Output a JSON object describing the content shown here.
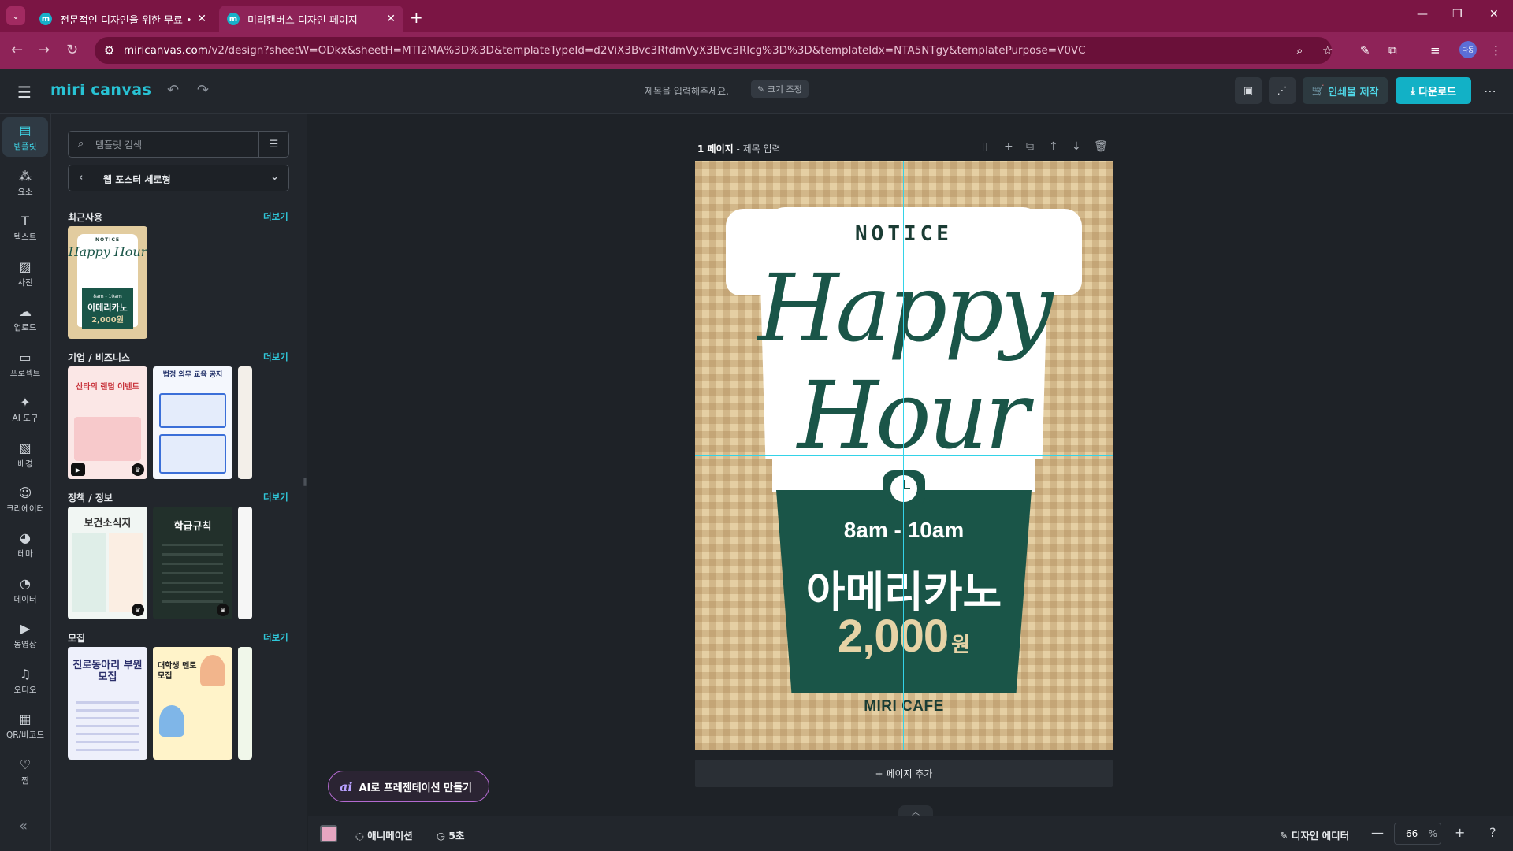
{
  "browser": {
    "tabs": [
      {
        "title": "전문적인 디자인을 위한 무료 •",
        "active": false
      },
      {
        "title": "미리캔버스 디자인 페이지",
        "active": true
      }
    ],
    "url_host": "miricanvas.com",
    "url_path": "/v2/design?sheetW=ODkx&sheetH=MTI2MA%3D%3D&templateTypeId=d2ViX3Bvc3RfdmVyX3Bvc3Rlcg%3D%3D&templateIdx=NTA5NTgy&templatePurpose=V0VC",
    "profile_initials": "다동"
  },
  "header": {
    "logo": "miri canvas",
    "doc_title_placeholder": "제목을 입력해주세요.",
    "resize_label": "크기 조정",
    "print_label": "인쇄물 제작",
    "download_label": "다운로드"
  },
  "rail": {
    "items": [
      {
        "label": "템플릿",
        "icon": "template-icon",
        "active": true
      },
      {
        "label": "요소",
        "icon": "elements-icon"
      },
      {
        "label": "텍스트",
        "icon": "text-icon"
      },
      {
        "label": "사진",
        "icon": "photo-icon"
      },
      {
        "label": "업로드",
        "icon": "upload-icon"
      },
      {
        "label": "프로젝트",
        "icon": "project-icon"
      },
      {
        "label": "AI 도구",
        "icon": "ai-tools-icon"
      },
      {
        "label": "배경",
        "icon": "background-icon"
      },
      {
        "label": "크리에이터",
        "icon": "creator-icon"
      },
      {
        "label": "테마",
        "icon": "theme-icon"
      },
      {
        "label": "데이터",
        "icon": "data-icon"
      },
      {
        "label": "동영상",
        "icon": "video-icon"
      },
      {
        "label": "오디오",
        "icon": "audio-icon"
      },
      {
        "label": "QR/바코드",
        "icon": "qr-icon"
      },
      {
        "label": "찜",
        "icon": "heart-icon"
      }
    ]
  },
  "panel": {
    "search_placeholder": "템플릿 검색",
    "category": "웹 포스터 세로형",
    "more_label": "더보기",
    "sections": [
      {
        "title": "최근사용"
      },
      {
        "title": "기업 / 비즈니스"
      },
      {
        "title": "정책 / 정보"
      },
      {
        "title": "모집"
      }
    ],
    "thumb_texts": {
      "recent": {
        "notice": "NOTICE",
        "script": "Happy Hour",
        "time": "8am - 10am",
        "drink": "아메리카노",
        "price": "2,000원"
      },
      "biz1": "산타의 랜덤 이벤트",
      "biz2": "법정 의무 교육 공지",
      "policy1": "보건소식지",
      "policy2": "학급규칙",
      "recruit1": "진로동아리 부원모집",
      "recruit2": "대학생 멘토 모집"
    }
  },
  "canvas": {
    "page_label_num": "1 페이지",
    "page_label_title": "제목 입력",
    "add_page": "페이지 추가",
    "ai_button": "AI로 프레젠테이션 만들기"
  },
  "poster": {
    "notice": "NOTICE",
    "line1": "Happy",
    "line2": "Hour",
    "time": "8am - 10am",
    "drink": "아메리카노",
    "price": "2,000",
    "price_unit": "원",
    "cafe": "MIRI CAFE",
    "colors": {
      "green": "#1a5548",
      "beige": "#e5cfa3",
      "accent": "#12b1c6"
    }
  },
  "bottom": {
    "animation": "애니메이션",
    "duration": "5초",
    "design_editor": "디자인 에디터",
    "zoom": "66",
    "zoom_unit": "%"
  }
}
